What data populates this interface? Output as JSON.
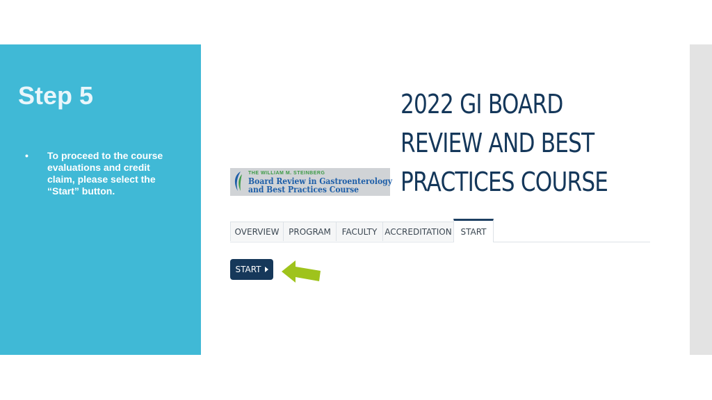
{
  "left_panel": {
    "step_title": "Step 5",
    "bullet_symbol": "•",
    "bullet_text": "To proceed to the course evaluations and credit claim, please select the “Start” button."
  },
  "course": {
    "title": "2022 GI BOARD REVIEW AND BEST PRACTICES COURSE"
  },
  "logo": {
    "top_line": "THE WILLIAM M. STEINBERG",
    "line1": "Board Review in Gastroenterology",
    "line2": "and Best Practices Course"
  },
  "tabs": [
    {
      "label": "OVERVIEW"
    },
    {
      "label": "PROGRAM"
    },
    {
      "label": "FACULTY"
    },
    {
      "label": "ACCREDITATION"
    },
    {
      "label": "START"
    }
  ],
  "start_button": {
    "label": "START"
  },
  "colors": {
    "panel": "#40b9d6",
    "title": "#14375a",
    "button": "#16385a",
    "arrow": "#9fc31c"
  }
}
